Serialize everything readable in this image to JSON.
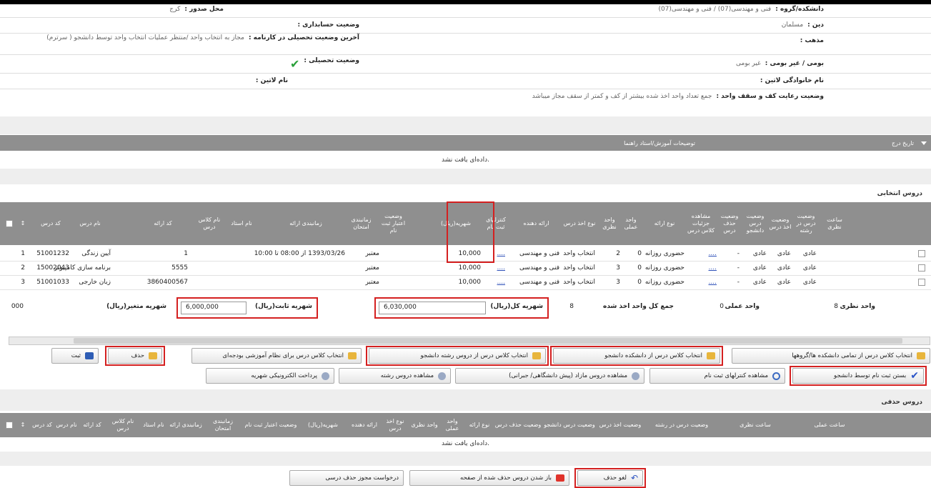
{
  "info": {
    "faculty_label": "دانشکده/گروه :",
    "faculty_value": "فنی و مهندسی(07) / فنی و مهندسی(07)",
    "issue_place_label": "محل صدور :",
    "issue_place_value": "کرج",
    "religion_label": "دین :",
    "religion_value": "مسلمان",
    "financial_label": "وضعیت حسابداری :",
    "sect_label": "مذهب :",
    "last_status_label": "آخرین وضعیت تحصیلی در کارنامه :",
    "last_status_value": "مجاز به انتخاب واحد /منتظر عملیات انتخاب واحد توسط دانشجو ( سرترم)",
    "native_label": "بومی / غیر بومی :",
    "native_value": "غیر بومی",
    "edu_status_label": "وضعیت تحصیلی :",
    "edu_status_mark": "✔",
    "family_latin_label": "نام خانوادگی لاتین :",
    "latin_name_label": "نام لاتین :",
    "units_label": "وضعیت رعایت کف و سقف واحد :",
    "units_value": "جمع تعداد واحد اخذ شده بیشتر از کف و کمتر از سقف مجاز میباشد"
  },
  "notes_bar": {
    "left": "تاریخ درج",
    "center": "توضیحات آموزش/استاد راهنما"
  },
  "no_data": "داده‌ای یافت نشد.",
  "selected": {
    "title": "دروس انتخابی",
    "headers": [
      "کد درس",
      "نام درس",
      "کد ارائه",
      "نام کلاس درس",
      "نام استاد",
      "زمانبندی ارائه",
      "زمانبندی امتحان",
      "وضعیت اعتبار ثبت نام",
      "شهریه(ریال)",
      "کنترلهای ثبت نام",
      "ارائه دهنده",
      "نوع اخذ درس",
      "واحد نظری",
      "واحد عملی",
      "نوع ارائه",
      "مشاهده جزئیات کلاس درس",
      "وضعیت حذف درس",
      "وضعیت درس دانشجو",
      "وضعیت اخذ درس",
      "وضعیت درس در رشته",
      "ساعت نظری"
    ],
    "rows": [
      {
        "num": "1",
        "code": "51001232",
        "name": "آیین زندگی",
        "offer": "1",
        "schedule": "1393/03/26 از 08:00 تا 10:00",
        "validity": "معتبر",
        "fee": "10,000",
        "ctrl": "....",
        "provider": "فنی و مهندسی",
        "take": "انتخاب واحد",
        "theory": "2",
        "practical": "0",
        "type": "حضوری روزانه",
        "detail": "....",
        "del": "-",
        "s1": "عادی",
        "s2": "عادی",
        "s3": "عادی"
      },
      {
        "num": "2",
        "code": "15002043",
        "name": "برنامه سازی کامپیوتر",
        "offer": "5555",
        "schedule": "",
        "validity": "معتبر",
        "fee": "10,000",
        "ctrl": "....",
        "provider": "فنی و مهندسی",
        "take": "انتخاب واحد",
        "theory": "3",
        "practical": "0",
        "type": "حضوری روزانه",
        "detail": "....",
        "del": "-",
        "s1": "عادی",
        "s2": "عادی",
        "s3": "عادی"
      },
      {
        "num": "3",
        "code": "51001033",
        "name": "زبان خارجی",
        "offer": "3860400567",
        "schedule": "",
        "validity": "معتبر",
        "fee": "10,000",
        "ctrl": "....",
        "provider": "فنی و مهندسی",
        "take": "انتخاب واحد",
        "theory": "3",
        "practical": "0",
        "type": "حضوری روزانه",
        "detail": "....",
        "del": "-",
        "s1": "عادی",
        "s2": "عادی",
        "s3": "عادی"
      }
    ],
    "summary": {
      "theory_label": "واحد نظری",
      "theory_value": "8",
      "practical_label": "واحد عملی",
      "practical_value": "0",
      "total_label": "جمع کل واحد اخذ شده",
      "total_value": "8",
      "total_fee_label": "شهریه کل(ریال)",
      "total_fee_value": "6,030,000",
      "fixed_fee_label": "شهریه ثابت(ریال)",
      "fixed_fee_value": "6,000,000",
      "variable_fee_label": "شهریه متغیر(ریال)",
      "variable_fee_value": "000"
    }
  },
  "buttons": {
    "select_all_faculties": "انتخاب کلاس درس از تمامی دانشکده ها/گروهها",
    "select_faculty": "انتخاب کلاس درس از دانشکده دانشجو",
    "select_major": "انتخاب کلاس درس از دروس رشته دانشجو",
    "select_old": "انتخاب کلاس درس برای نظام آموزشی بودجه‌ای",
    "delete": "حذف",
    "save": "ثبت",
    "close_registration": "بستن ثبت نام توسط دانشجو",
    "view_controls": "مشاهده کنترلهای ثبت نام",
    "view_extra": "مشاهده دروس مازاد (پیش دانشگاهی/ جبرانی)",
    "view_major": "مشاهده دروس رشته",
    "pay_fee": "پرداخت الکترونیکی شهریه",
    "undo_delete": "لغو حذف",
    "restore_deleted": "باز شدن دروس حذف شده از صفحه",
    "request_drop": "درخواست مجوز حذف درسی"
  },
  "deleted": {
    "title": "دروس حذفی",
    "headers": [
      "کد درس",
      "نام درس",
      "کد ارائه",
      "نام کلاس درس",
      "نام استاد",
      "زمانبندی ارائه",
      "زمانبندی امتحان",
      "وضعیت اعتبار ثبت نام",
      "شهریه(ریال)",
      "ارائه دهنده",
      "نوع اخذ درس",
      "واحد نظری",
      "واحد عملی",
      "نوع ارائه",
      "وضعیت حذف درس",
      "وضعیت درس دانشجو",
      "وضعیت اخذ درس",
      "وضعیت درس در رشته",
      "ساعت نظری",
      "ساعت عملی"
    ]
  }
}
